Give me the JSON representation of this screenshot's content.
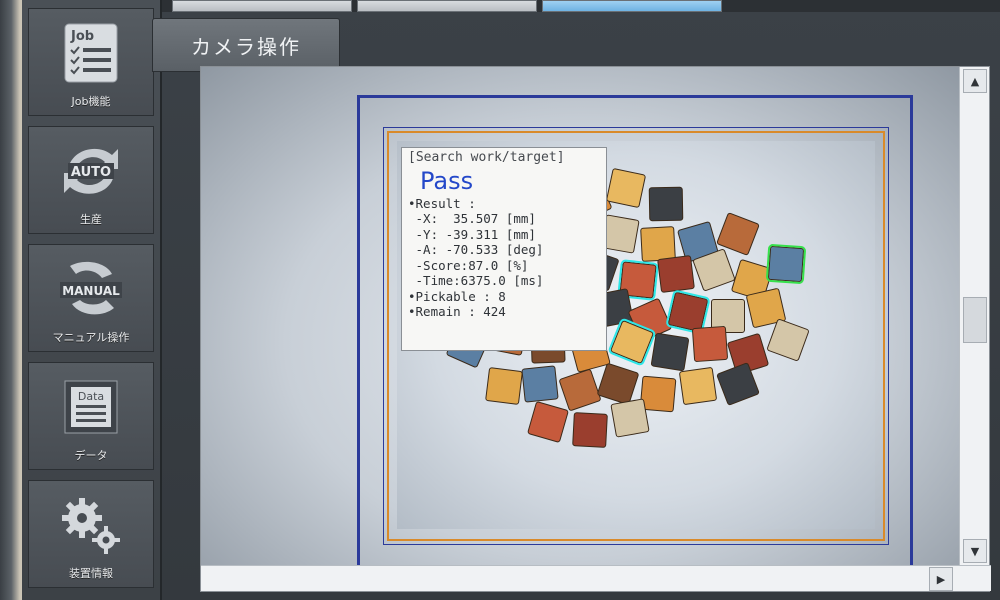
{
  "sidebar": {
    "items": [
      {
        "label": "Job機能",
        "icon": "job-clipboard-icon",
        "icon_text": "Job"
      },
      {
        "label": "生産",
        "icon": "auto-mode-icon",
        "icon_text": "AUTO"
      },
      {
        "label": "マニュアル操作",
        "icon": "manual-mode-icon",
        "icon_text": "MANUAL"
      },
      {
        "label": "データ",
        "icon": "data-document-icon",
        "icon_text": "Data"
      },
      {
        "label": "装置情報",
        "icon": "gear-icon",
        "icon_text": ""
      }
    ]
  },
  "main": {
    "tab_label": "カメラ操作"
  },
  "result": {
    "header": "[Search work/target]",
    "status": "Pass",
    "status_color": "#2448c9",
    "lines": [
      "•Result :",
      " -X:  35.507 [mm]",
      " -Y: -39.311 [mm]",
      " -A: -70.533 [deg]",
      " -Score:87.0 [%]",
      " -Time:6375.0 [ms]",
      "•Pickable : 8",
      "•Remain : 424"
    ]
  },
  "colors": {
    "tray_outline": "#2b3a9a",
    "search_roi": "#d98a2a",
    "detected_outline": "#2de7e7",
    "best_target_outline": "#36e14b"
  }
}
